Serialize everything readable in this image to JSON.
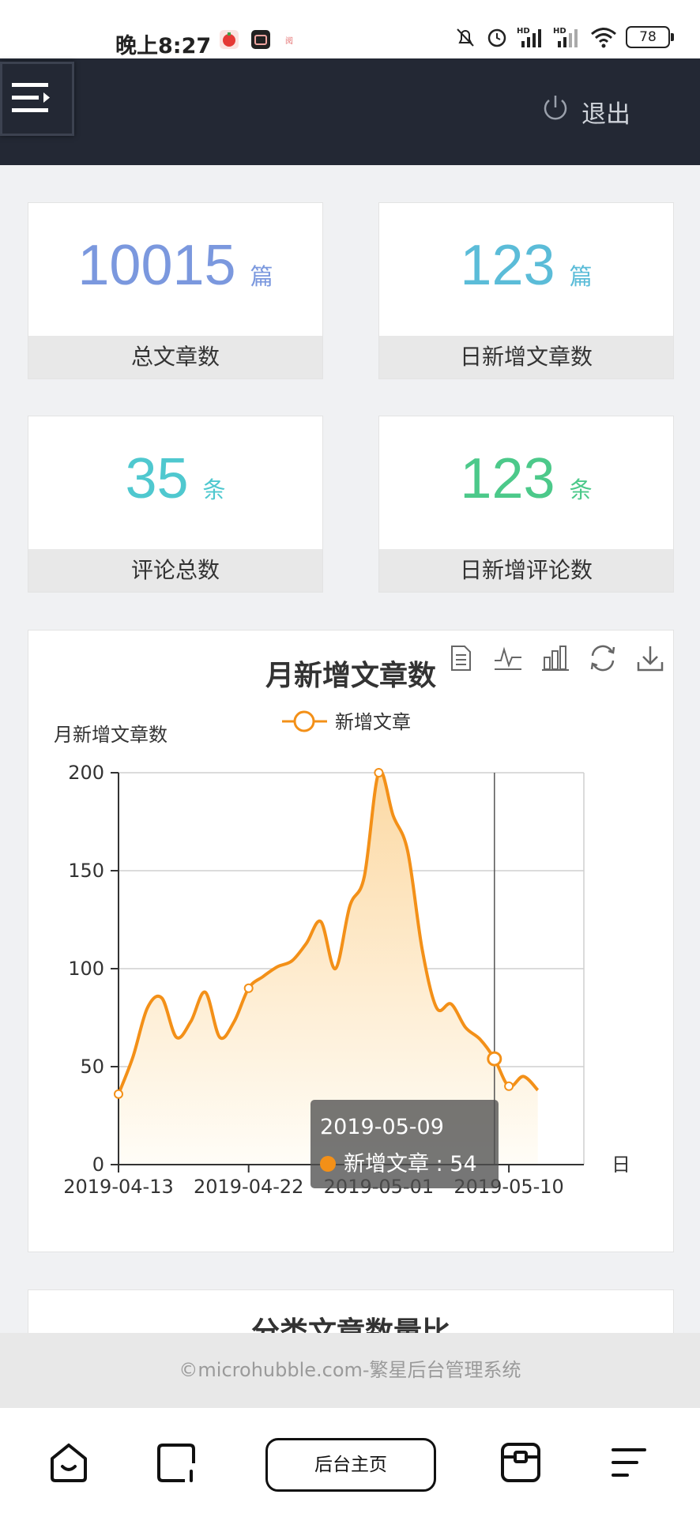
{
  "status_bar": {
    "time": "晚上8:27",
    "battery": "78",
    "network_label": "HD",
    "app_icons": [
      "tomato-app-icon",
      "camera-app-icon",
      "reader-app-icon"
    ],
    "app_icon_colors": [
      "#e53935",
      "#222222",
      "#ff8a80"
    ]
  },
  "header": {
    "menu_icon": "menu-fold-icon",
    "logout_label": "退出",
    "logout_icon": "power-icon"
  },
  "stats": [
    {
      "value": "10015",
      "unit": "篇",
      "label": "总文章数",
      "color": "#7b98de"
    },
    {
      "value": "123",
      "unit": "篇",
      "label": "日新增文章数",
      "color": "#5bbcd8"
    },
    {
      "value": "35",
      "unit": "条",
      "label": "评论总数",
      "color": "#4fc8cf"
    },
    {
      "value": "123",
      "unit": "条",
      "label": "日新增评论数",
      "color": "#4cc98a"
    }
  ],
  "chart_panel": {
    "title": "月新增文章数",
    "toolbox": [
      "data-view-icon",
      "line-chart-icon",
      "bar-chart-icon",
      "restore-icon",
      "download-icon"
    ]
  },
  "chart_data": {
    "type": "area",
    "title": "月新增文章数",
    "ylabel": "月新增文章数",
    "xlabel": "日",
    "legend": "top-center",
    "grid": true,
    "ylim": [
      0,
      200
    ],
    "yticks": [
      "0",
      "50",
      "100",
      "150",
      "200"
    ],
    "xticks": [
      "2019-04-13",
      "2019-04-22",
      "2019-05-01",
      "2019-05-10"
    ],
    "series": [
      {
        "name": "新增文章",
        "color": "#f39018",
        "x": [
          "2019-04-13",
          "2019-04-14",
          "2019-04-15",
          "2019-04-16",
          "2019-04-17",
          "2019-04-18",
          "2019-04-19",
          "2019-04-20",
          "2019-04-21",
          "2019-04-22",
          "2019-04-23",
          "2019-04-24",
          "2019-04-25",
          "2019-04-26",
          "2019-04-27",
          "2019-04-28",
          "2019-04-29",
          "2019-04-30",
          "2019-05-01",
          "2019-05-02",
          "2019-05-03",
          "2019-05-04",
          "2019-05-05",
          "2019-05-06",
          "2019-05-07",
          "2019-05-08",
          "2019-05-09",
          "2019-05-10",
          "2019-05-11",
          "2019-05-12"
        ],
        "values": [
          36,
          55,
          80,
          85,
          65,
          73,
          88,
          65,
          73,
          90,
          96,
          101,
          104,
          113,
          124,
          100,
          132,
          147,
          200,
          178,
          160,
          110,
          80,
          82,
          70,
          64,
          54,
          40,
          45,
          38
        ]
      }
    ],
    "highlight_points": [
      "2019-04-13",
      "2019-04-22",
      "2019-05-01",
      "2019-05-09",
      "2019-05-10"
    ],
    "tooltip": {
      "date": "2019-05-09",
      "series": "新增文章",
      "value": "54",
      "text": "新增文章 : 54"
    }
  },
  "panel2": {
    "title": "分类文章数量比"
  },
  "footer": {
    "text": "©microhubble.com-繁星后台管理系统"
  },
  "navbar": {
    "home_label": "后台主页",
    "icons": [
      "home-icon",
      "window-icon",
      "card-icon",
      "sort-menu-icon"
    ]
  }
}
